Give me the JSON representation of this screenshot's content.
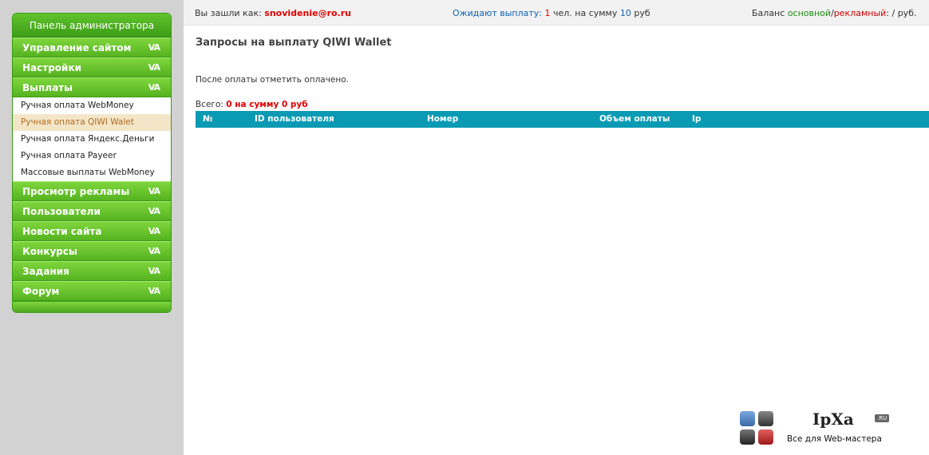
{
  "sidebar": {
    "title": "Панель администратора",
    "sections_top": [
      {
        "label": "Управление сайтом",
        "chevron": "VA"
      },
      {
        "label": "Настройки",
        "chevron": "VA"
      },
      {
        "label": "Выплаты",
        "chevron": "VA"
      }
    ],
    "payouts_items": [
      {
        "label": "Ручная оплата WebMoney"
      },
      {
        "label": "Ручная оплата QIWI Walet",
        "active": true
      },
      {
        "label": "Ручная оплата Яндекс.Деньги"
      },
      {
        "label": "Ручная оплата Payeer"
      },
      {
        "label": "Массовые выплаты WebMoney"
      }
    ],
    "sections_bottom": [
      {
        "label": "Просмотр рекламы",
        "chevron": "VA"
      },
      {
        "label": "Пользователи",
        "chevron": "VA"
      },
      {
        "label": "Новости сайта",
        "chevron": "VA"
      },
      {
        "label": "Конкурсы",
        "chevron": "VA"
      },
      {
        "label": "Задания",
        "chevron": "VA"
      },
      {
        "label": "Форум",
        "chevron": "VA"
      }
    ]
  },
  "topbar": {
    "login_label": "Вы зашли как:",
    "login_user": "snovidenie@ro.ru",
    "pending_label": "Ожидают выплату:",
    "pending_count": "1",
    "pending_mid": "чел. на сумму",
    "pending_sum": "10",
    "pending_unit": "руб",
    "balance_label": "Баланс",
    "balance_main": "основной",
    "balance_sep": "/",
    "balance_ad": "рекламный",
    "balance_tail": ": / руб."
  },
  "main": {
    "title": "Запросы на выплату QIWI Wallet",
    "note": "После оплаты отметить оплачено.",
    "total_label": "Всего:",
    "total_value": "0 на сумму 0 руб",
    "columns": [
      "№",
      "ID пользователя",
      "Номер",
      "Объем оплаты",
      "Ip"
    ]
  },
  "logo": {
    "name": "IpXa",
    "tld": ".RU",
    "tagline": "Все для Web-мастера",
    "colors": [
      "#4a7ab8",
      "#555555",
      "#444444",
      "#c83030"
    ]
  }
}
